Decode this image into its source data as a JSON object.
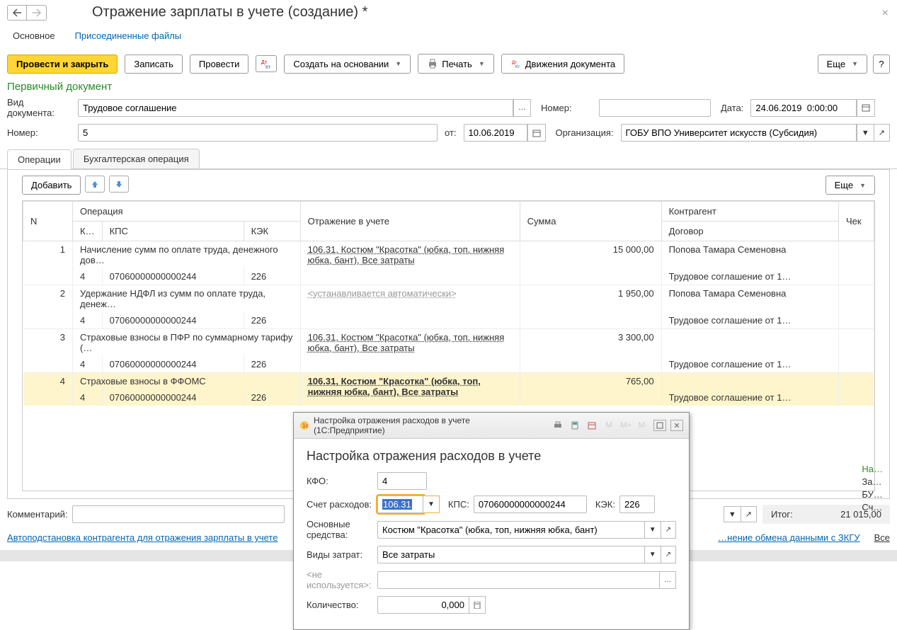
{
  "window": {
    "title": "Отражение зарплаты в учете (создание) *"
  },
  "subnav": {
    "main": "Основное",
    "files": "Присоединенные файлы"
  },
  "toolbar": {
    "post_close": "Провести и закрыть",
    "record": "Записать",
    "post": "Провести",
    "create_based": "Создать на основании",
    "print": "Печать",
    "movements": "Движения документа",
    "more": "Еще",
    "help": "?"
  },
  "primary_doc": {
    "section": "Первичный документ",
    "doc_type_label": "Вид документа:",
    "doc_type_value": "Трудовое соглашение",
    "number_right_label": "Номер:",
    "date_label": "Дата:",
    "date_value": "24.06.2019  0:00:00",
    "number_label": "Номер:",
    "number_value": "5",
    "ot_label": "от:",
    "ot_value": "10.06.2019",
    "org_label": "Организация:",
    "org_value": "ГОБУ ВПО Университет искусств (Субсидия)"
  },
  "tabs": {
    "ops": "Операции",
    "accounting": "Бухгалтерская операция"
  },
  "table_toolbar": {
    "add": "Добавить",
    "more": "Еще"
  },
  "columns": {
    "n": "N",
    "operation": "Операция",
    "reflection": "Отражение в учете",
    "sum": "Сумма",
    "counterparty": "Контрагент",
    "check": "Чек",
    "k": "К…",
    "kps": "КПС",
    "kek": "КЭК",
    "contract": "Договор"
  },
  "rows": [
    {
      "n": "1",
      "op": "Начисление сумм по оплате труда, денежного дов…",
      "k": "4",
      "kps": "07060000000000244",
      "kek": "226",
      "refl": "106.31, Костюм \"Красотка\" (юбка, топ, нижняя юбка, бант), Все затраты",
      "sum": "15 000,00",
      "cp": "Попова Тамара Семеновна",
      "contract": "Трудовое соглашение от 1…"
    },
    {
      "n": "2",
      "op": "Удержание НДФЛ из сумм по оплате труда, денеж…",
      "k": "4",
      "kps": "07060000000000244",
      "kek": "226",
      "refl_auto": "<устанавливается автоматически>",
      "sum": "1 950,00",
      "cp": "Попова Тамара Семеновна",
      "contract": "Трудовое соглашение от 1…"
    },
    {
      "n": "3",
      "op": "Страховые взносы в ПФР по суммарному тарифу (…",
      "k": "4",
      "kps": "07060000000000244",
      "kek": "226",
      "refl": "106.31, Костюм \"Красотка\" (юбка, топ, нижняя юбка, бант), Все затраты",
      "sum": "3 300,00",
      "cp": "",
      "contract": "Трудовое соглашение от 1…"
    },
    {
      "n": "4",
      "op": "Страховые взносы в ФФОМС",
      "k": "4",
      "kps": "07060000000000244",
      "kek": "226",
      "refl": "106.31, Костюм \"Красотка\" (юбка, топ, нижняя юбка, бант), Все затраты",
      "sum": "765,00",
      "cp": "",
      "contract": "Трудовое соглашение от 1…"
    }
  ],
  "footer": {
    "comment_label": "Комментарий:",
    "autosub_link": "Автоподстановка контрагента для отражения зарплаты в учете",
    "exchange_link": "…нение обмена данными с ЗКГУ",
    "all": "Все",
    "total_label": "Итог:",
    "total_value": "21 015,00"
  },
  "dialog": {
    "title": "Настройка отражения расходов в учете  (1С:Предприятие)",
    "heading": "Настройка отражения расходов в учете",
    "kfo_label": "КФО:",
    "kfo_value": "4",
    "acct_label": "Счет расходов:",
    "acct_value": "106.31",
    "kps_label": "КПС:",
    "kps_value": "07060000000000244",
    "kek_label": "КЭК:",
    "kek_value": "226",
    "os_label": "Основные средства:",
    "os_value": "Костюм \"Красотка\" (юбка, топ, нижняя юбка, бант)",
    "costs_label": "Виды затрат:",
    "costs_value": "Все затраты",
    "unused": "<не используется>:",
    "qty_label": "Количество:",
    "qty_value": "0,000",
    "mem_m": "M",
    "mem_mp": "M+",
    "mem_mm": "M-"
  },
  "hidden_panel": {
    "title": "На…",
    "line1": "За…",
    "line2": "БУ…",
    "line3": "Сч…"
  }
}
